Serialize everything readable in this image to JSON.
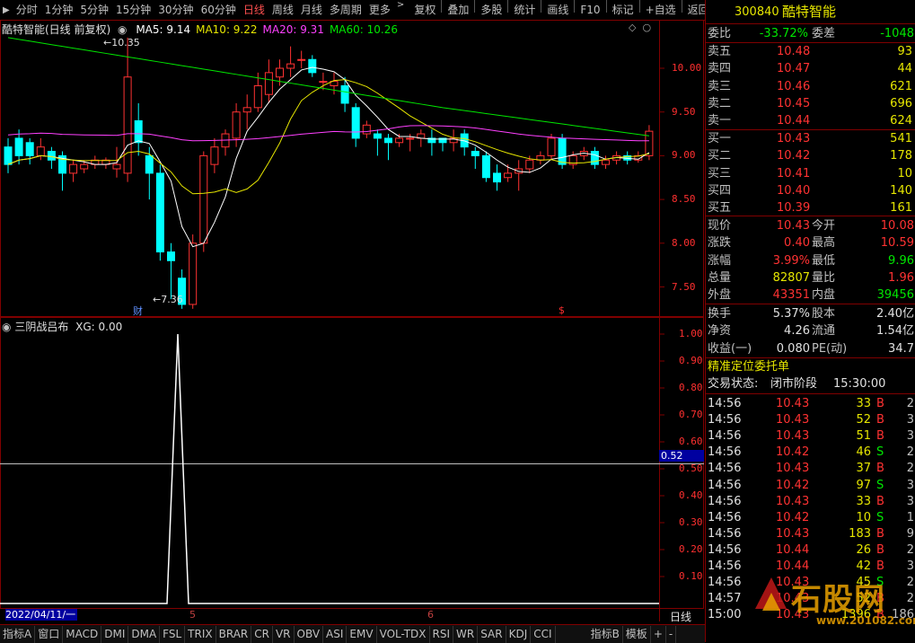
{
  "toolbar": {
    "periods": [
      "分时",
      "1分钟",
      "5分钟",
      "15分钟",
      "30分钟",
      "60分钟",
      "日线",
      "周线",
      "月线",
      "多周期",
      "更多"
    ],
    "active_period": "日线",
    "tools": [
      "复权",
      "叠加",
      "多股",
      "统计",
      "画线",
      "F10",
      "标记",
      "+自选",
      "返回"
    ]
  },
  "chart": {
    "title": "酷特智能(日线 前复权)",
    "ma": [
      {
        "label": "MA5: 9.14",
        "color": "#ffffff"
      },
      {
        "label": "MA10: 9.22",
        "color": "#e6e600"
      },
      {
        "label": "MA20: 9.31",
        "color": "#ff40ff"
      },
      {
        "label": "MA60: 10.26",
        "color": "#00e600"
      }
    ],
    "high_mark": "10.35",
    "low_mark": "7.36",
    "y_ticks": [
      "10.00",
      "9.50",
      "9.00",
      "8.50",
      "8.00",
      "7.50"
    ],
    "cai_mark": "财",
    "dollar_mark": "$"
  },
  "indicator": {
    "title": "三阴战吕布",
    "xg": "XG: 0.00",
    "y_ticks": [
      "1.00",
      "0.90",
      "0.80",
      "0.70",
      "0.60",
      "0.50",
      "0.40",
      "0.30",
      "0.20",
      "0.10"
    ],
    "cursor_value": "0.52"
  },
  "xaxis": {
    "date": "2022/04/11/一",
    "m5": "5",
    "m6": "6",
    "period": "日线"
  },
  "bottom_tabs": [
    "指标A",
    "窗口",
    "MACD",
    "DMI",
    "DMA",
    "FSL",
    "TRIX",
    "BRAR",
    "CR",
    "VR",
    "OBV",
    "ASI",
    "EMV",
    "VOL-TDX",
    "RSI",
    "WR",
    "SAR",
    "KDJ",
    "CCI",
    "指标B",
    "模板",
    "+",
    "-"
  ],
  "quote": {
    "code": "300840",
    "name": "酷特智能",
    "weibi_label": "委比",
    "weibi": "-33.72%",
    "weicha_label": "委差",
    "weicha": "-1048",
    "asks": [
      {
        "label": "卖五",
        "price": "10.48",
        "vol": "93"
      },
      {
        "label": "卖四",
        "price": "10.47",
        "vol": "44"
      },
      {
        "label": "卖三",
        "price": "10.46",
        "vol": "621"
      },
      {
        "label": "卖二",
        "price": "10.45",
        "vol": "696"
      },
      {
        "label": "卖一",
        "price": "10.44",
        "vol": "624"
      }
    ],
    "bids": [
      {
        "label": "买一",
        "price": "10.43",
        "vol": "541"
      },
      {
        "label": "买二",
        "price": "10.42",
        "vol": "178"
      },
      {
        "label": "买三",
        "price": "10.41",
        "vol": "10"
      },
      {
        "label": "买四",
        "price": "10.40",
        "vol": "140"
      },
      {
        "label": "买五",
        "price": "10.39",
        "vol": "161"
      }
    ],
    "stats": [
      {
        "l1": "现价",
        "v1": "10.43",
        "c1": "red",
        "l2": "今开",
        "v2": "10.08",
        "c2": "red"
      },
      {
        "l1": "涨跌",
        "v1": "0.40",
        "c1": "red",
        "l2": "最高",
        "v2": "10.59",
        "c2": "red"
      },
      {
        "l1": "涨幅",
        "v1": "3.99%",
        "c1": "red",
        "l2": "最低",
        "v2": "9.96",
        "c2": "green"
      },
      {
        "l1": "总量",
        "v1": "82807",
        "c1": "yellow",
        "l2": "量比",
        "v2": "1.96",
        "c2": "red"
      },
      {
        "l1": "外盘",
        "v1": "43351",
        "c1": "red",
        "l2": "内盘",
        "v2": "39456",
        "c2": "green"
      }
    ],
    "stats2": [
      {
        "l1": "换手",
        "v1": "5.37%",
        "l2": "股本",
        "v2": "2.40亿"
      },
      {
        "l1": "净资",
        "v1": "4.26",
        "l2": "流通",
        "v2": "1.54亿"
      },
      {
        "l1": "收益(一)",
        "v1": "0.080",
        "l2": "PE(动)",
        "v2": "34.7"
      }
    ],
    "precise_order": "精准定位委托单",
    "trade_state_label": "交易状态:",
    "trade_state": "闭市阶段",
    "trade_time": "15:30:00",
    "ticks": [
      {
        "t": "14:56",
        "p": "10.43",
        "v": "33",
        "s": "B",
        "n": "2"
      },
      {
        "t": "14:56",
        "p": "10.43",
        "v": "52",
        "s": "B",
        "n": "3"
      },
      {
        "t": "14:56",
        "p": "10.43",
        "v": "51",
        "s": "B",
        "n": "3"
      },
      {
        "t": "14:56",
        "p": "10.42",
        "v": "46",
        "s": "S",
        "n": "2"
      },
      {
        "t": "14:56",
        "p": "10.43",
        "v": "37",
        "s": "B",
        "n": "2"
      },
      {
        "t": "14:56",
        "p": "10.42",
        "v": "97",
        "s": "S",
        "n": "3"
      },
      {
        "t": "14:56",
        "p": "10.43",
        "v": "33",
        "s": "B",
        "n": "3"
      },
      {
        "t": "14:56",
        "p": "10.42",
        "v": "10",
        "s": "S",
        "n": "1"
      },
      {
        "t": "14:56",
        "p": "10.43",
        "v": "183",
        "s": "B",
        "n": "9"
      },
      {
        "t": "14:56",
        "p": "10.44",
        "v": "26",
        "s": "B",
        "n": "2"
      },
      {
        "t": "14:56",
        "p": "10.44",
        "v": "42",
        "s": "B",
        "n": "3"
      },
      {
        "t": "14:56",
        "p": "10.43",
        "v": "45",
        "s": "S",
        "n": "2"
      },
      {
        "t": "14:57",
        "p": "10.43",
        "v": "52",
        "s": "B",
        "n": "2"
      },
      {
        "t": "15:00",
        "p": "10.43",
        "v": "1396",
        "s": "B",
        "n": "186"
      }
    ],
    "watermark": "石股网",
    "watermark_url": "www.201082.com"
  },
  "colors": {
    "up": "#ff3232",
    "down": "#00ffff",
    "frame": "#800000"
  }
}
